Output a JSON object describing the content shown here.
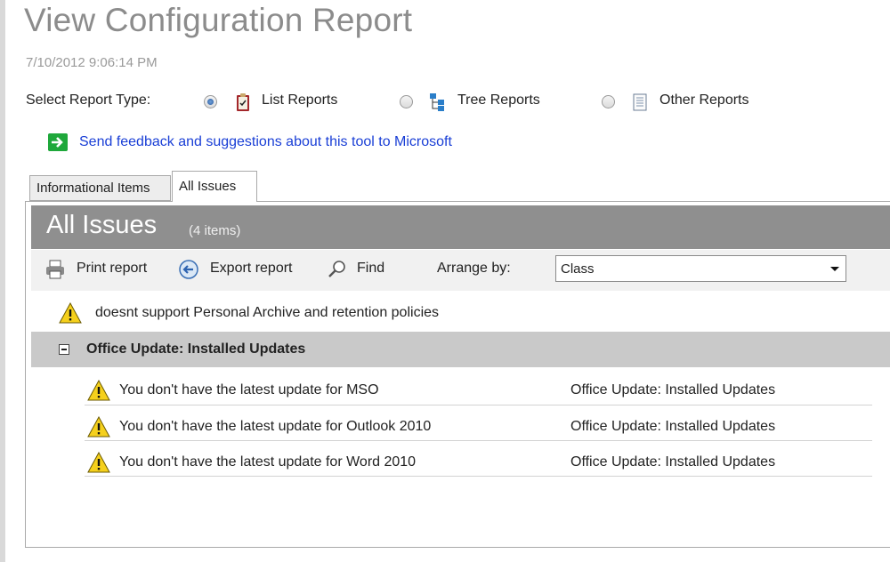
{
  "page": {
    "title": "View Configuration Report",
    "timestamp": "7/10/2012 9:06:14 PM"
  },
  "report_type": {
    "label": "Select Report Type:",
    "options": [
      {
        "label": "List Reports",
        "selected": true,
        "icon": "clipboard-list-icon"
      },
      {
        "label": "Tree Reports",
        "selected": false,
        "icon": "tree-hierarchy-icon"
      },
      {
        "label": "Other Reports",
        "selected": false,
        "icon": "document-icon"
      }
    ]
  },
  "feedback": {
    "link_text": "Send feedback and suggestions about this tool to Microsoft",
    "icon": "green-arrow-icon"
  },
  "tabs": [
    {
      "label": "Informational Items",
      "active": false
    },
    {
      "label": "All Issues",
      "active": true
    }
  ],
  "issues_panel": {
    "title": "All Issues",
    "count": "(4 items)",
    "toolbar": {
      "print_label": "Print report",
      "export_label": "Export report",
      "find_label": "Find",
      "arrange_label": "Arrange by:",
      "arrange_value": "Class"
    },
    "ungrouped_issue": "doesnt support Personal Archive and retention policies",
    "group": {
      "label": "Office Update: Installed Updates",
      "items": [
        {
          "text": "You don't have the latest update for MSO",
          "category": "Office Update: Installed Updates"
        },
        {
          "text": "You don't have the latest update for Outlook 2010",
          "category": "Office Update: Installed Updates"
        },
        {
          "text": "You don't have the latest update for Word 2010",
          "category": "Office Update: Installed Updates"
        }
      ]
    }
  },
  "colors": {
    "header_bar": "#8f8f8f",
    "group_bar": "#c9c9c9",
    "link": "#1a3fd6",
    "warning": "#f5d01c"
  }
}
